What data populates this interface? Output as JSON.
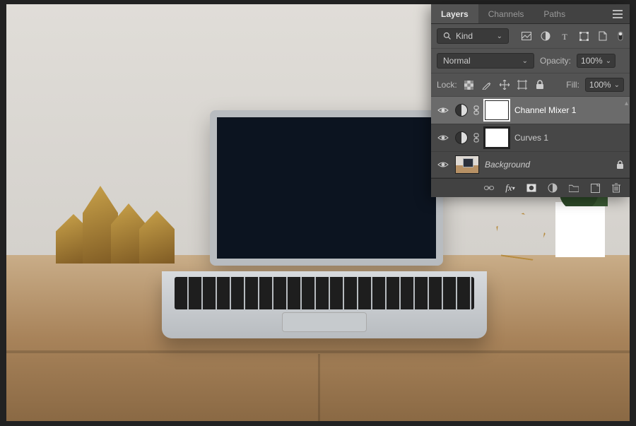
{
  "panel": {
    "tabs": {
      "layers": "Layers",
      "channels": "Channels",
      "paths": "Paths"
    },
    "filter_label": "Kind",
    "blend_mode": "Normal",
    "opacity_label": "Opacity:",
    "opacity_value": "100%",
    "lock_label": "Lock:",
    "fill_label": "Fill:",
    "fill_value": "100%",
    "layers": [
      {
        "name": "Channel Mixer 1"
      },
      {
        "name": "Curves 1"
      },
      {
        "name": "Background"
      }
    ]
  }
}
